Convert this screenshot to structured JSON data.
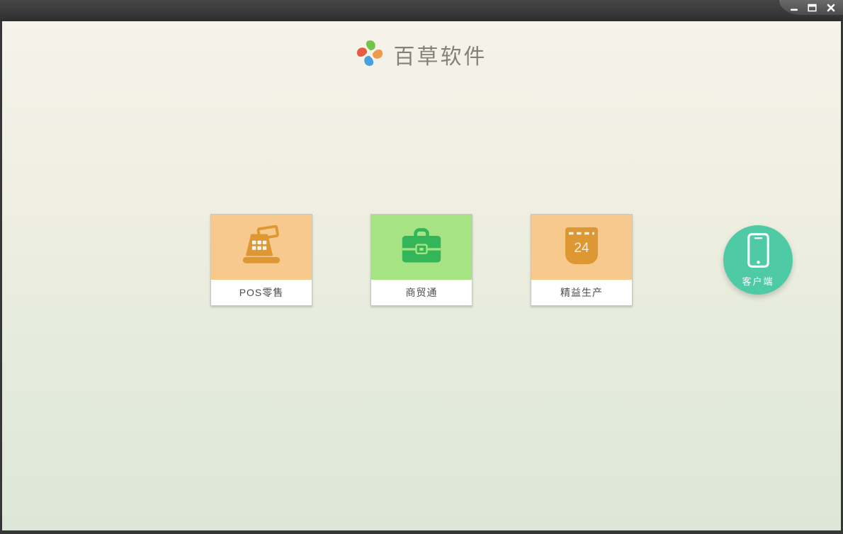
{
  "window": {
    "controls": [
      {
        "icon": "minimize-icon"
      },
      {
        "icon": "maximize-icon"
      },
      {
        "icon": "close-icon"
      }
    ]
  },
  "header": {
    "logo_icon": "pinwheel-logo",
    "app_title": "百草软件"
  },
  "products": [
    {
      "label": "POS零售",
      "icon": "cash-register-icon",
      "tile_bg": "#f8c98c",
      "icon_color": "#dd9733"
    },
    {
      "label": "商贸通",
      "icon": "briefcase-icon",
      "tile_bg": "#a5e383",
      "icon_color": "#33b55a"
    },
    {
      "label": "精益生产",
      "icon": "calendar-icon",
      "tile_bg": "#f8c98c",
      "icon_color": "#dd9733",
      "calendar_day": "24"
    }
  ],
  "client_button": {
    "label": "客户端",
    "icon": "smartphone-icon",
    "bg_color": "#4ecaa5"
  },
  "colors": {
    "titlebar": "#3a3a3a",
    "frame_border": "#363636",
    "content_gradient_top": "#f5f3ea",
    "content_gradient_bottom": "#dce7d8",
    "title_text": "#82827a",
    "card_label_text": "#4c4c4c",
    "logo_green": "#72c548",
    "logo_orange": "#f09a4b",
    "logo_blue": "#4b9fdf",
    "logo_red": "#e75b3f"
  }
}
